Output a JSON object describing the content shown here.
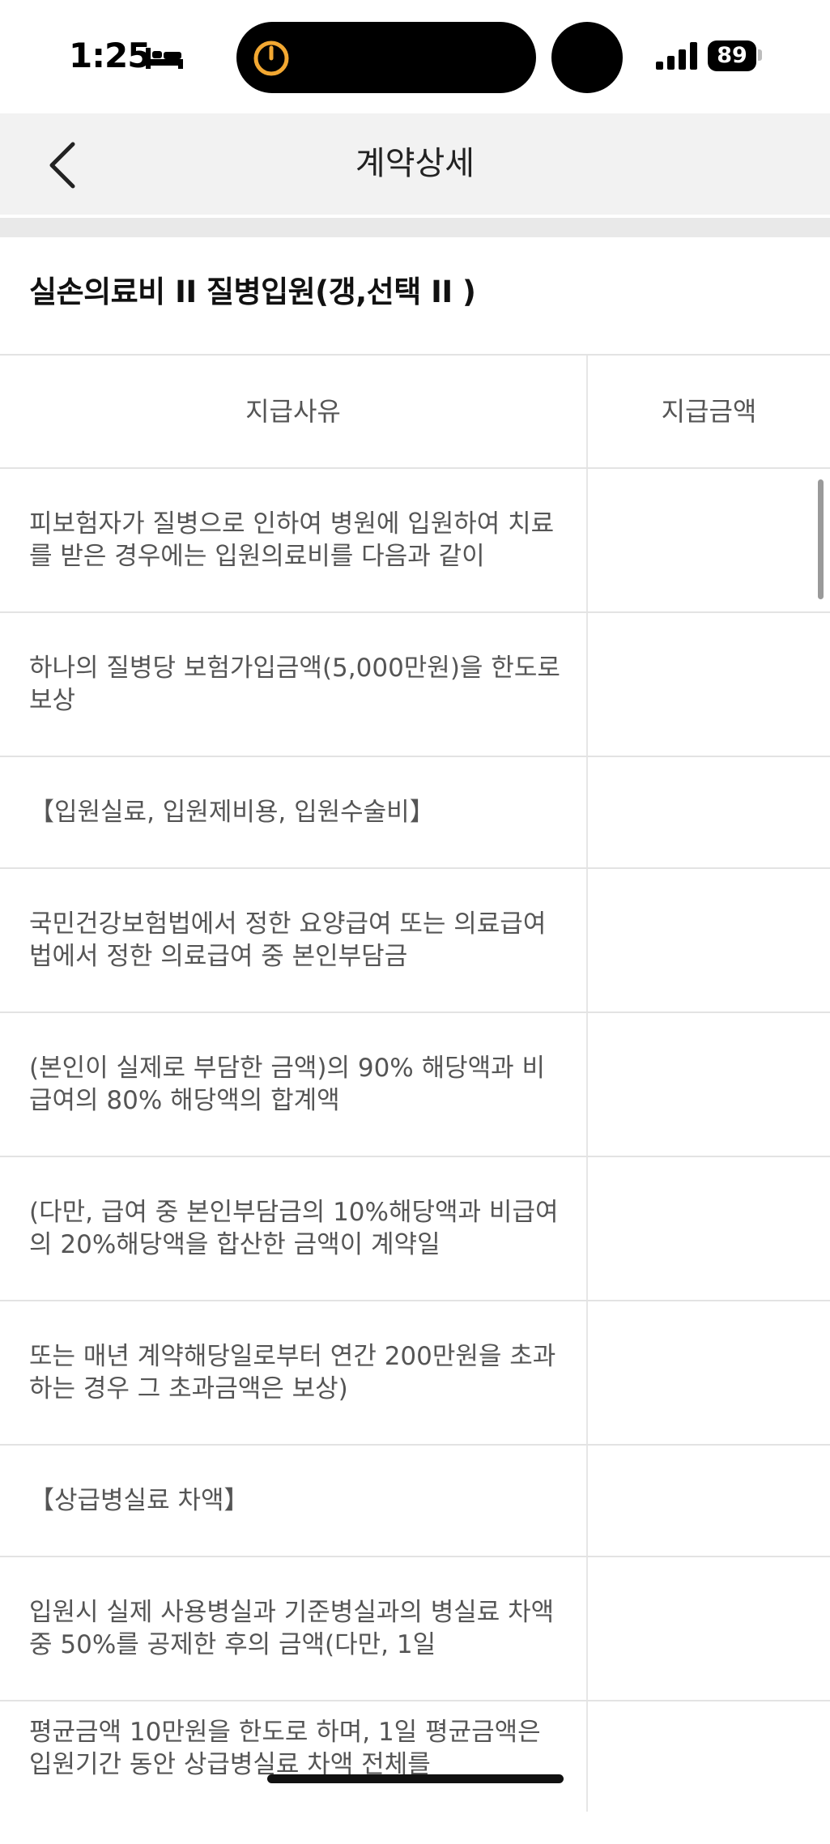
{
  "status_bar": {
    "time": "1:25",
    "battery": "89",
    "icons": [
      "bed-icon",
      "timer-icon",
      "signal-icon",
      "battery-icon"
    ]
  },
  "header": {
    "title": "계약상세",
    "back_icon": "chevron-left-icon"
  },
  "section": {
    "title": "실손의료비 II 질병입원(갱,선택 II )"
  },
  "table": {
    "columns": [
      "지급사유",
      "지급금액"
    ],
    "rows": [
      {
        "reason": "피보험자가 질병으로 인하여 병원에 입원하여 치료를 받은 경우에는 입원의료비를 다음과 같이",
        "amount": ""
      },
      {
        "reason": "하나의 질병당 보험가입금액(5,000만원)을 한도로 보상",
        "amount": ""
      },
      {
        "reason": "【입원실료, 입원제비용, 입원수술비】",
        "amount": ""
      },
      {
        "reason": "국민건강보험법에서 정한 요양급여 또는 의료급여법에서 정한 의료급여 중 본인부담금",
        "amount": ""
      },
      {
        "reason": "(본인이 실제로 부담한 금액)의 90% 해당액과 비급여의 80% 해당액의 합계액",
        "amount": ""
      },
      {
        "reason": "(다만, 급여 중 본인부담금의 10%해당액과 비급여의 20%해당액을 합산한 금액이 계약일",
        "amount": ""
      },
      {
        "reason": "또는 매년 계약해당일로부터 연간 200만원을 초과하는 경우 그 초과금액은 보상)",
        "amount": ""
      },
      {
        "reason": "【상급병실료 차액】",
        "amount": ""
      },
      {
        "reason": "입원시 실제 사용병실과 기준병실과의 병실료 차액 중 50%를 공제한 후의 금액(다만, 1일",
        "amount": ""
      },
      {
        "reason": "평균금액 10만원을 한도로 하며, 1일 평균금액은 입원기간 동안 상급병실료 차액 전체를",
        "amount": ""
      }
    ]
  },
  "colors": {
    "nav_background": "#f2f2f2",
    "divider": "#e3e3e3",
    "text_muted": "#555555"
  }
}
